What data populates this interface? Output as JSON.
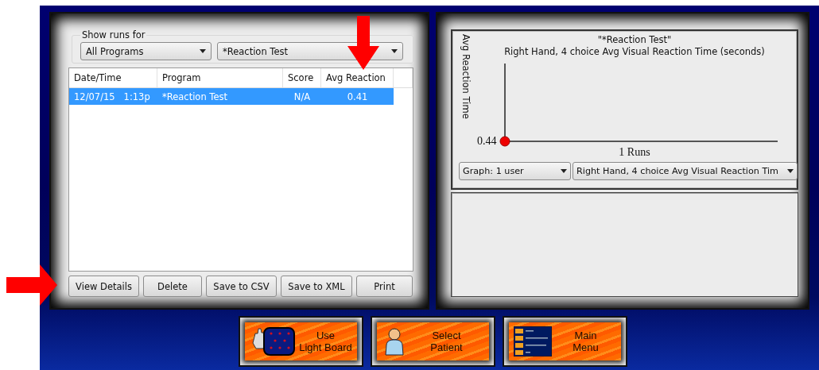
{
  "filter": {
    "label": "Show runs for",
    "program": "All Programs",
    "test": "*Reaction Test"
  },
  "table": {
    "columns": [
      "Date/Time",
      "Program",
      "Score",
      "Avg Reaction"
    ],
    "rows": [
      {
        "cells": [
          "12/07/15   1:13p",
          "*Reaction Test",
          "N/A",
          "0.41"
        ],
        "selected": true
      }
    ]
  },
  "actions": [
    "View Details",
    "Delete",
    "Save to CSV",
    "Save to XML",
    "Print"
  ],
  "graph": {
    "title": "\"*Reaction Test\"",
    "subtitle": "Right Hand, 4 choice Avg Visual Reaction Time (seconds)",
    "ylabel": "Avg Reaction Time",
    "point_label": "0.44",
    "xlabel": "1 Runs",
    "mode": "Graph: 1 user",
    "measure": "Right Hand, 4 choice Avg Visual Reaction Tim"
  },
  "nav": [
    {
      "kind": "lightboard",
      "lines": [
        "Use",
        "Light Board"
      ]
    },
    {
      "kind": "patient",
      "lines": [
        "Select",
        "Patient"
      ]
    },
    {
      "kind": "menu",
      "lines": [
        "Main",
        "Menu"
      ]
    }
  ],
  "annotations": [
    {
      "kind": "down-arrow"
    },
    {
      "kind": "right-arrow"
    }
  ]
}
